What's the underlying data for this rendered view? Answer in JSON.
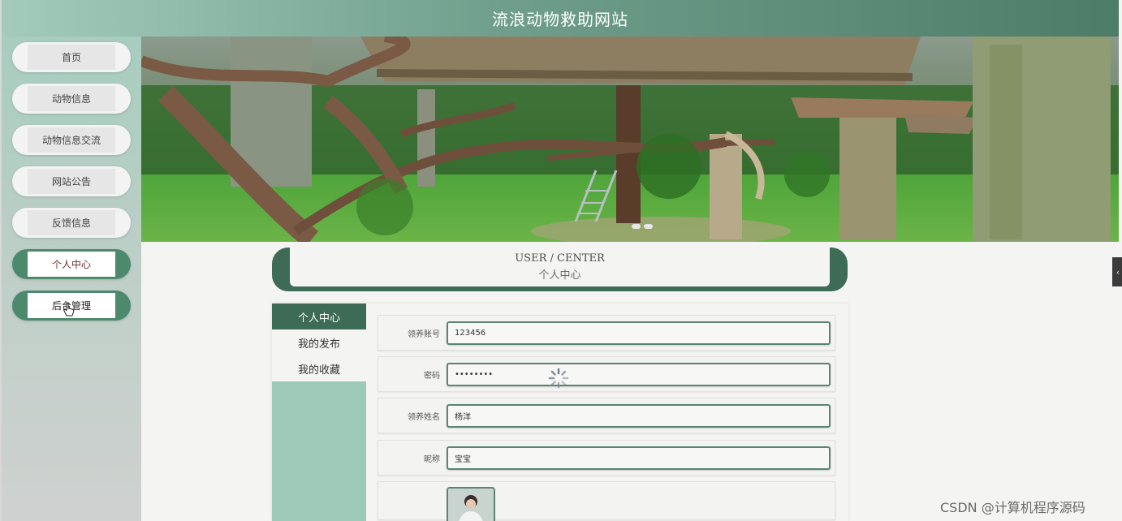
{
  "header": {
    "title": "流浪动物救助网站"
  },
  "sidebar": {
    "items": [
      {
        "label": "首页"
      },
      {
        "label": "动物信息"
      },
      {
        "label": "动物信息交流"
      },
      {
        "label": "网站公告"
      },
      {
        "label": "反馈信息"
      },
      {
        "label": "个人中心"
      },
      {
        "label": "后台管理"
      }
    ]
  },
  "section": {
    "title_en": "USER / CENTER",
    "title_cn": "个人中心"
  },
  "tabs": [
    {
      "label": "个人中心"
    },
    {
      "label": "我的发布"
    },
    {
      "label": "我的收藏"
    }
  ],
  "form": {
    "account": {
      "label": "领养账号",
      "value": "123456"
    },
    "password": {
      "label": "密码",
      "value": "••••••••"
    },
    "name": {
      "label": "领养姓名",
      "value": "杨洋"
    },
    "nickname": {
      "label": "昵称",
      "value": "宝宝"
    }
  },
  "side_handle": {
    "icon": "‹"
  },
  "watermark": "CSDN @计算机程序源码",
  "colors": {
    "accent": "#3d6b55",
    "sidebar": "#a7cdbf",
    "header_start": "#a4cbbc",
    "header_end": "#4d7d68"
  }
}
